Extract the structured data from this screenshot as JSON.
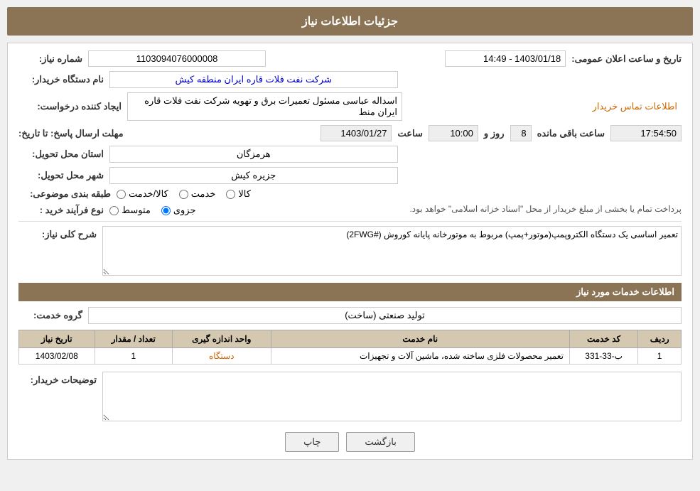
{
  "header": {
    "title": "جزئیات اطلاعات نیاز"
  },
  "form": {
    "shomara_niaz_label": "شماره نیاز:",
    "shomara_niaz_value": "1103094076000008",
    "nam_dastgah_label": "نام دستگاه خریدار:",
    "nam_dastgah_value": "شرکت نفت فلات قاره ایران منطقه کیش",
    "ejad_konande_label": "ایجاد کننده درخواست:",
    "ejad_konande_value": "اسداله عباسی  مسئول تعمیرات برق و تهویه  شرکت نفت فلات قاره ایران منط",
    "ettelaat_tamas_label": "اطلاعات تماس خریدار",
    "mohlat_ersal_label": "مهلت ارسال پاسخ: تا تاریخ:",
    "tarikh_value": "1403/01/27",
    "saat_label": "ساعت",
    "saat_value": "10:00",
    "rooz_label": "روز و",
    "rooz_value": "8",
    "baqi_label": "ساعت باقی مانده",
    "baqi_value": "17:54:50",
    "tarikh_elan_label": "تاریخ و ساعت اعلان عمومی:",
    "tarikh_elan_value": "1403/01/18 - 14:49",
    "ostan_label": "استان محل تحویل:",
    "ostan_value": "هرمزگان",
    "shahr_label": "شهر محل تحویل:",
    "shahr_value": "جزیره کیش",
    "tabaqe_bandi_label": "طبقه بندی موضوعی:",
    "radio_kala": "کالا",
    "radio_khedmat": "خدمت",
    "radio_kala_khedmat": "کالا/خدمت",
    "now_farayand_label": "نوع فرآیند خرید :",
    "radio_jozvi": "جزوی",
    "radio_mootavsat": "متوسط",
    "note": "پرداخت تمام یا بخشی از مبلغ خریدار از محل \"اسناد خزانه اسلامی\" خواهد بود.",
    "sharh_kolli_label": "شرح کلی نیاز:",
    "sharh_kolli_value": "تعمیر اساسی یک دستگاه الکتروپمپ(موتور+پمپ) مربوط به موتورخانه پایانه کوروش (#2FWG)",
    "ettelaat_khadamat_title": "اطلاعات خدمات مورد نیاز",
    "goroh_khedmat_label": "گروه خدمت:",
    "goroh_khedmat_value": "تولید صنعتی (ساخت)",
    "buyer_comment_label": "توضیحات خریدار:",
    "buyer_comment_value": ""
  },
  "table": {
    "headers": [
      "ردیف",
      "کد خدمت",
      "نام خدمت",
      "واحد اندازه گیری",
      "تعداد / مقدار",
      "تاریخ نیاز"
    ],
    "rows": [
      {
        "radif": "1",
        "code": "ب-33-331",
        "name": "تعمیر محصولات فلزی ساخته شده، ماشین آلات و تجهیزات",
        "unit": "دستگاه",
        "count": "1",
        "date": "1403/02/08"
      }
    ]
  },
  "buttons": {
    "print_label": "چاپ",
    "back_label": "بازگشت"
  }
}
